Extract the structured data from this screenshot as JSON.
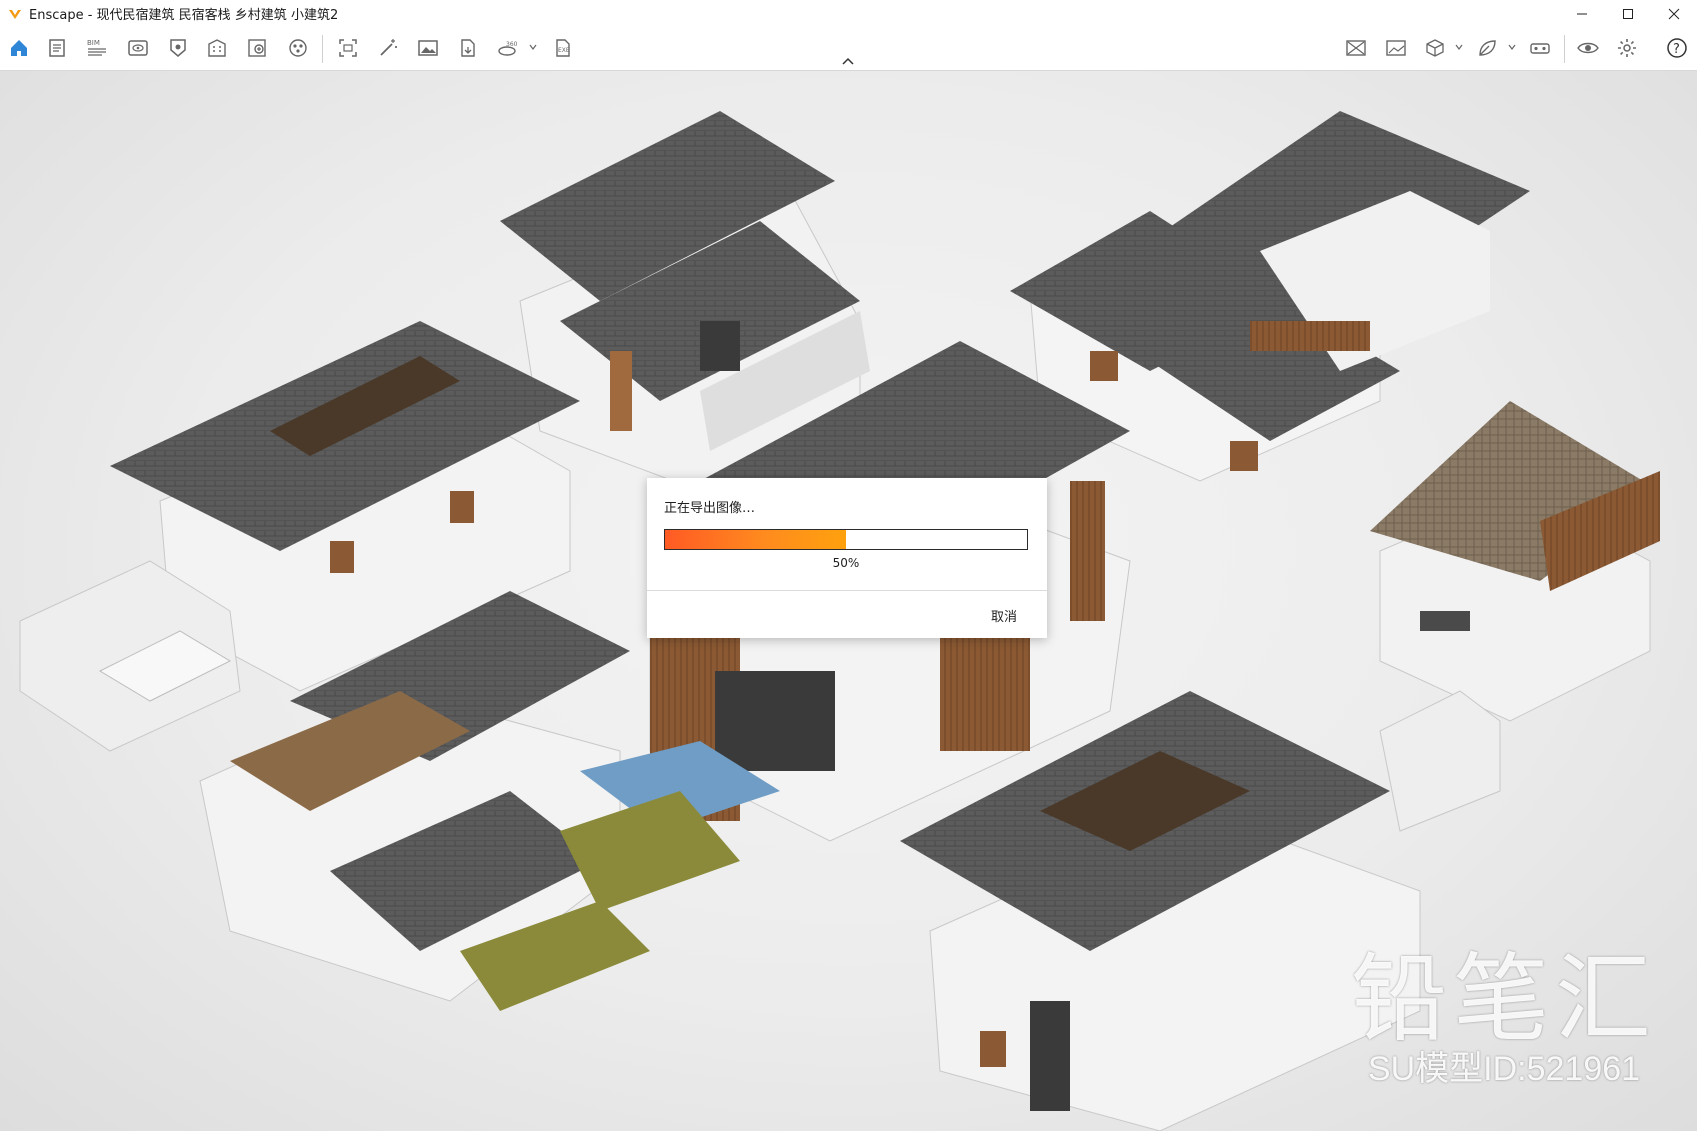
{
  "window": {
    "title": "Enscape - 现代民宿建筑 民宿客栈 乡村建筑 小建筑2",
    "accent_color": "#f39c12"
  },
  "toolbar": {
    "left_tools": [
      {
        "icon": "home-icon",
        "active": true
      },
      {
        "icon": "document-icon"
      },
      {
        "icon": "bim-icon",
        "label": "BIM"
      },
      {
        "icon": "view-icon"
      },
      {
        "icon": "compass-icon"
      },
      {
        "icon": "building-icon"
      },
      {
        "icon": "asset-library-icon"
      },
      {
        "icon": "material-icon"
      },
      {
        "icon": "capture-icon"
      },
      {
        "icon": "magic-wand-icon"
      },
      {
        "icon": "image-icon"
      },
      {
        "icon": "document-export-icon"
      },
      {
        "icon": "panorama-360-icon",
        "label": "360"
      },
      {
        "icon": "exe-export-icon",
        "label": "EXE"
      }
    ],
    "right_tools": [
      {
        "icon": "no-image-icon"
      },
      {
        "icon": "picture-icon"
      },
      {
        "icon": "box-icon"
      },
      {
        "icon": "leaf-icon"
      },
      {
        "icon": "vr-headset-icon"
      },
      {
        "icon": "eye-icon"
      },
      {
        "icon": "settings-icon"
      },
      {
        "icon": "help-icon"
      }
    ]
  },
  "dialog": {
    "title": "正在导出图像…",
    "progress_percent": 50,
    "progress_text": "50%",
    "cancel_label": "取消",
    "progress_colors": [
      "#ff5a24",
      "#ffa10e"
    ]
  },
  "watermark": {
    "brand": "铅笔汇",
    "model_id": "SU模型ID:521961"
  }
}
